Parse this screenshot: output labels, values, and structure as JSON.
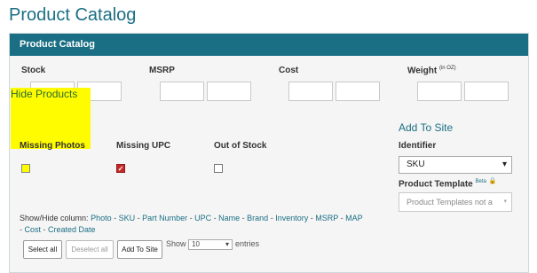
{
  "page_title": "Product Catalog",
  "panel_title": "Product Catalog",
  "filters": {
    "stock": "Stock",
    "msrp": "MSRP",
    "cost": "Cost",
    "weight": "Weight",
    "weight_unit": "(in OZ)"
  },
  "hide_products": {
    "title": "Hide Products",
    "missing_photos": "Missing Photos",
    "missing_upc": "Missing UPC",
    "out_of_stock": "Out of Stock"
  },
  "add_to_site": {
    "title": "Add To Site",
    "identifier_label": "Identifier",
    "identifier_value": "SKU",
    "template_label": "Product Template",
    "template_badge": "Beta",
    "template_placeholder": "Product Templates not a"
  },
  "showhide": {
    "label": "Show/Hide column:",
    "columns": [
      "Photo",
      "SKU",
      "Part Number",
      "UPC",
      "Name",
      "Brand",
      "Inventory",
      "MSRP",
      "MAP",
      "Cost",
      "Created Date"
    ]
  },
  "buttons": {
    "select_all": "Select all",
    "deselect_all": "Deselect all",
    "add_to_site": "Add To Site"
  },
  "entries": {
    "show": "Show",
    "value": "10",
    "entries": "entries"
  },
  "colors": {
    "accent": "#1b6f84",
    "highlight": "#fffc00",
    "checked": "#c62828"
  },
  "icons": {
    "chevron": "chevron-down-icon",
    "lock": "lock-icon"
  }
}
